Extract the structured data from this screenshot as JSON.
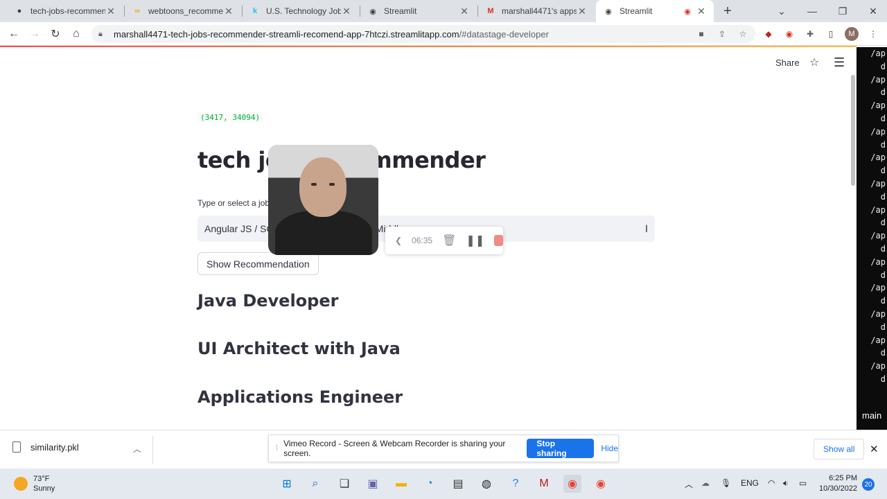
{
  "browser": {
    "tabs": [
      {
        "title": "tech-jobs-recommend",
        "icon": "github-icon",
        "active": false
      },
      {
        "title": "webtoons_recommen",
        "icon": "colab-icon",
        "active": false
      },
      {
        "title": "U.S. Technology Jobs",
        "icon": "kaggle-icon",
        "active": false
      },
      {
        "title": "Streamlit",
        "icon": "streamlit-icon",
        "active": false
      },
      {
        "title": "marshall4471's apps",
        "icon": "gmail-icon",
        "active": false
      },
      {
        "title": "Streamlit",
        "icon": "streamlit-icon",
        "active": true
      }
    ],
    "url_host": "marshall4471-tech-jobs-recommender-streamli-recomend-app-7htczi.streamlitapp.com",
    "url_path": "/#datastage-developer",
    "profile_initial": "M"
  },
  "app": {
    "share_label": "Share",
    "shape_text": "(3417, 34094)",
    "title": "tech jobs recommender",
    "select_label": "Type or select a job from the dropdown",
    "select_value": "Angular JS / SOA / Java / Spring Boot / Middleware",
    "button_label": "Show Recommendation",
    "recommendations": [
      "Java Developer",
      "UI Architect with Java",
      "Applications Engineer"
    ]
  },
  "recorder": {
    "elapsed": "06:35"
  },
  "terminal": {
    "lines": [
      "/ap",
      "d",
      "/ap",
      "d",
      "/ap",
      "d",
      "/ap",
      "d",
      "/ap",
      "d",
      "/ap",
      "d",
      "/ap",
      "d",
      "/ap",
      "d",
      "/ap",
      "d",
      "/ap",
      "d",
      "/ap",
      "d",
      "/ap",
      "d",
      "/ap",
      "d"
    ],
    "branch": "main"
  },
  "downloads": {
    "file_name": "similarity.pkl",
    "show_all_label": "Show all"
  },
  "sharing_bar": {
    "message": "Vimeo Record - Screen & Webcam Recorder is sharing your screen.",
    "stop_label": "Stop sharing",
    "hide_label": "Hide"
  },
  "taskbar": {
    "temperature": "73°F",
    "condition": "Sunny",
    "language": "ENG",
    "time": "6:25 PM",
    "date": "10/30/2022",
    "notifications": "20"
  }
}
